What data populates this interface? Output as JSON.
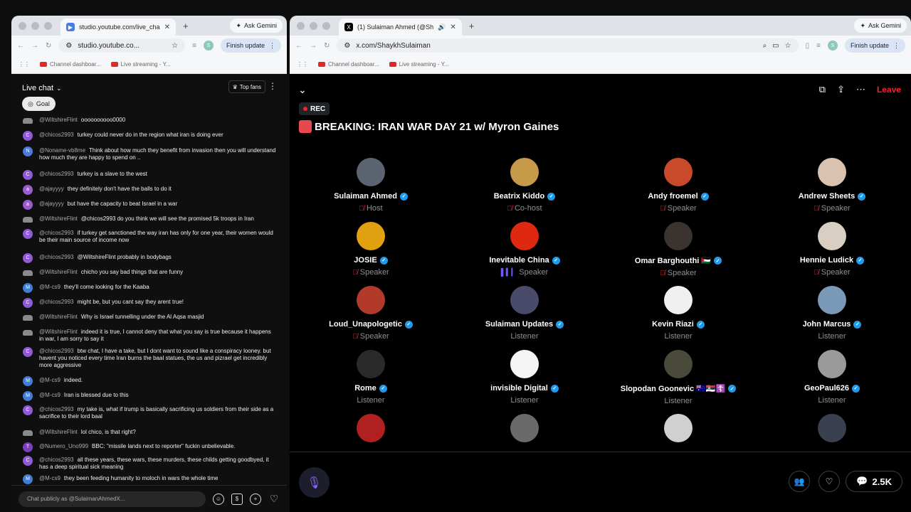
{
  "left_window": {
    "tab_title": "studio.youtube.com/live_cha",
    "ask_gemini": "Ask Gemini",
    "url": "studio.youtube.co...",
    "finish_update": "Finish update",
    "profile_initial": "S",
    "bookmarks": [
      "Channel dashboar...",
      "Live streaming - Y..."
    ]
  },
  "chat": {
    "title": "Live chat",
    "top_fans": "Top fans",
    "goal": "Goal",
    "input_placeholder": "Chat publicly as @SulaimanAhmedX...",
    "messages": [
      {
        "initial": "",
        "color": "#8a8a8a",
        "user": "@WiltshireFlint",
        "text": "oooooooooo0000"
      },
      {
        "initial": "C",
        "color": "#8f5ad6",
        "user": "@chicos2993",
        "text": "turkey could never do in the region what iran is doing ever"
      },
      {
        "initial": "N",
        "color": "#4a7bd8",
        "user": "@Noname-vb8me",
        "text": "Think about how much they benefit from invasion then you will understand how much they are happy to spend on .."
      },
      {
        "initial": "C",
        "color": "#8f5ad6",
        "user": "@chicos2993",
        "text": "turkey is a slave to the west"
      },
      {
        "initial": "a",
        "color": "#9a5ad0",
        "user": "@ajayyyy",
        "text": "they definitely don't have the balls to do it"
      },
      {
        "initial": "a",
        "color": "#9a5ad0",
        "user": "@ajayyyy",
        "text": "but have the capacity to beat Israel in a war"
      },
      {
        "initial": "",
        "color": "#8a8a8a",
        "user": "@WiltshireFlint",
        "text": "@chicos2993 do you think we will see the promised 5k troops in Iran"
      },
      {
        "initial": "C",
        "color": "#8f5ad6",
        "user": "@chicos2993",
        "text": "if turkey get sanctioned the way iran has only for one year, their women would be their main source of income now"
      },
      {
        "initial": "C",
        "color": "#8f5ad6",
        "user": "@chicos2993",
        "text": "@WiltshireFlint probably in bodybags"
      },
      {
        "initial": "",
        "color": "#8a8a8a",
        "user": "@WiltshireFlint",
        "text": "chicho you say bad things that are funny"
      },
      {
        "initial": "M",
        "color": "#3f7ed6",
        "user": "@M-cs9",
        "text": "they'll come looking for the Kaaba"
      },
      {
        "initial": "C",
        "color": "#8f5ad6",
        "user": "@chicos2993",
        "text": "might be, but you cant say they arent true!"
      },
      {
        "initial": "",
        "color": "#8a8a8a",
        "user": "@WiltshireFlint",
        "text": "Why is Israel tunnelling under the Al Aqsa masjid"
      },
      {
        "initial": "",
        "color": "#8a8a8a",
        "user": "@WiltshireFlint",
        "text": "indeed it is true, I cannot deny that what you say is true because it happens in war, I am sorry to say it"
      },
      {
        "initial": "C",
        "color": "#8f5ad6",
        "user": "@chicos2993",
        "text": "btw chat, I have a take, but I dont want to sound like a conspiracy looney. but havent you noticed every time Iran burns the baal statues, the us and pizrael get incredibly more aggressive"
      },
      {
        "initial": "M",
        "color": "#3f7ed6",
        "user": "@M-cs9",
        "text": "indeed."
      },
      {
        "initial": "M",
        "color": "#3f7ed6",
        "user": "@M-cs9",
        "text": "Iran is blessed due to this"
      },
      {
        "initial": "C",
        "color": "#8f5ad6",
        "user": "@chicos2993",
        "text": "my take is, what if trump is basically sacrificing us soldiers from their side as a sacrifice to their lord baal"
      },
      {
        "initial": "",
        "color": "#8a8a8a",
        "user": "@WiltshireFlint",
        "text": "lol chico, is that right?"
      },
      {
        "initial": "T",
        "color": "#7b3fb8",
        "user": "@Numero_Uno999",
        "text": "BBC: \"missile lands next to reporter\" fuckin unbelievable."
      },
      {
        "initial": "C",
        "color": "#8f5ad6",
        "user": "@chicos2993",
        "text": "all these years, these wars, these murders, these childs getting goodbyed, it has a deep spiritual sick meaning"
      },
      {
        "initial": "M",
        "color": "#3f7ed6",
        "user": "@M-cs9",
        "text": "they been feeding humanity to moloch in wars the whole time"
      }
    ]
  },
  "right_window": {
    "tab_title": "(1) Sulaiman Ahmed (@Sh",
    "ask_gemini": "Ask Gemini",
    "url": "x.com/ShaykhSulaiman",
    "finish_update": "Finish update",
    "profile_initial": "S",
    "bookmarks": [
      "Channel dashboar...",
      "Live streaming - Y..."
    ]
  },
  "space": {
    "leave": "Leave",
    "rec": "REC",
    "title": "BREAKING: IRAN WAR DAY 21 w/ Myron Gaines",
    "listener_count": "2.5K",
    "people": [
      {
        "name": "Sulaiman Ahmed",
        "role": "Host",
        "state": "muted",
        "color": "#5b6470"
      },
      {
        "name": "Beatrix Kiddo",
        "role": "Co-host",
        "state": "muted",
        "color": "#c79a4a"
      },
      {
        "name": "Andy froemel",
        "role": "Speaker",
        "state": "muted",
        "color": "#c94a2a"
      },
      {
        "name": "Andrew Sheets",
        "role": "Speaker",
        "state": "muted",
        "color": "#d9c3b0"
      },
      {
        "name": "JOSIE",
        "role": "Speaker",
        "state": "muted",
        "color": "#e0a010"
      },
      {
        "name": "Inevitable China",
        "role": "Speaker",
        "state": "speaking",
        "color": "#de2910"
      },
      {
        "name": "Omar Barghouthi 🇵🇸",
        "role": "Speaker",
        "state": "muted",
        "color": "#3a3330"
      },
      {
        "name": "Hennie Ludick",
        "role": "Speaker",
        "state": "muted",
        "color": "#d8cfc2"
      },
      {
        "name": "Loud_Unapologetic",
        "role": "Speaker",
        "state": "muted",
        "color": "#b23a2a"
      },
      {
        "name": "Sulaiman Updates",
        "role": "Listener",
        "state": "none",
        "color": "#4a4a6a"
      },
      {
        "name": "Kevin Riazi",
        "role": "Listener",
        "state": "none",
        "color": "#f0f0f0"
      },
      {
        "name": "John Marcus",
        "role": "Listener",
        "state": "none",
        "color": "#7a9ab8"
      },
      {
        "name": "Rome",
        "role": "Listener",
        "state": "none",
        "color": "#2a2a2a"
      },
      {
        "name": "invisible Digital",
        "role": "Listener",
        "state": "none",
        "color": "#f5f5f5"
      },
      {
        "name": "Slopodan Goonevic 🇦🇺🇷🇸☦️",
        "role": "Listener",
        "state": "none",
        "color": "#4a4a3a"
      },
      {
        "name": "GeoPaul626",
        "role": "Listener",
        "state": "none",
        "color": "#9a9a9a"
      },
      {
        "name": "",
        "role": "",
        "state": "none",
        "color": "#b02020"
      },
      {
        "name": "",
        "role": "",
        "state": "none",
        "color": "#6a6a6a"
      },
      {
        "name": "",
        "role": "",
        "state": "none",
        "color": "#d0d0d0"
      },
      {
        "name": "",
        "role": "",
        "state": "none",
        "color": "#3a4050"
      }
    ]
  }
}
